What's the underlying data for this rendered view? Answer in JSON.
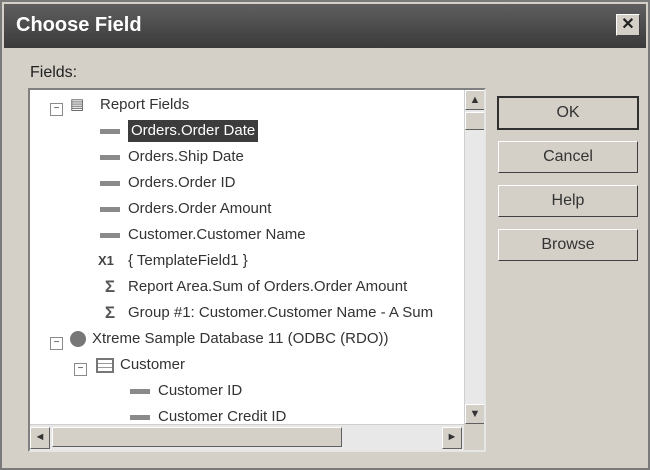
{
  "window": {
    "title": "Choose Field",
    "close_glyph": "✕"
  },
  "fields_label": "Fields:",
  "tree": {
    "items": [
      {
        "label": "Report Fields",
        "icon": "report-icon"
      },
      {
        "label": "Orders.Order Date",
        "icon": "field-icon",
        "selected": true
      },
      {
        "label": "Orders.Ship Date",
        "icon": "field-icon"
      },
      {
        "label": "Orders.Order ID",
        "icon": "field-icon"
      },
      {
        "label": "Orders.Order Amount",
        "icon": "field-icon"
      },
      {
        "label": "Customer.Customer Name",
        "icon": "field-icon"
      },
      {
        "label": "{ TemplateField1 }",
        "icon": "template-field-icon"
      },
      {
        "label": "Report Area.Sum of Orders.Order Amount",
        "icon": "sigma-icon"
      },
      {
        "label": "Group #1: Customer.Customer Name - A Sum",
        "icon": "sigma-icon"
      },
      {
        "label": "Xtreme Sample Database 11 (ODBC (RDO))",
        "icon": "database-icon"
      },
      {
        "label": "Customer",
        "icon": "table-icon"
      },
      {
        "label": "Customer ID",
        "icon": "field-icon"
      },
      {
        "label": "Customer Credit ID",
        "icon": "field-icon"
      }
    ],
    "expand_glyph": "−"
  },
  "buttons": {
    "ok": "OK",
    "cancel": "Cancel",
    "help": "Help",
    "browse": "Browse"
  },
  "scroll_glyphs": {
    "up": "▲",
    "down": "▼",
    "left": "◄",
    "right": "►"
  }
}
